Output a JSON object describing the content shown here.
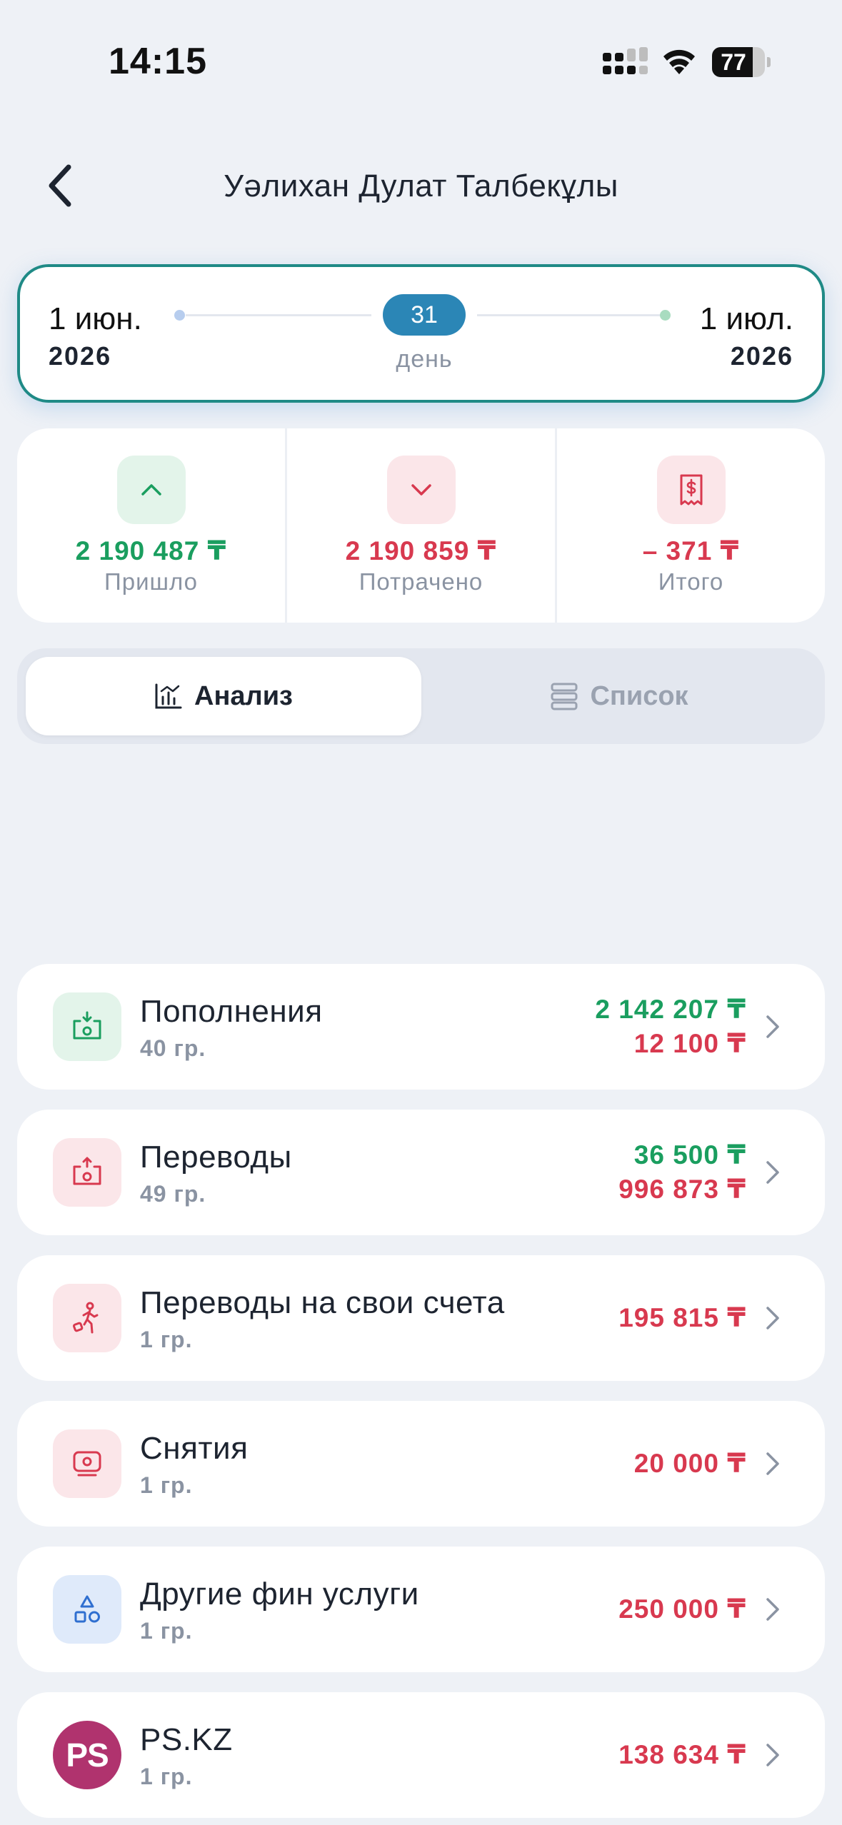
{
  "status_bar": {
    "time": "14:15",
    "battery": "77",
    "battery_level": 0.77
  },
  "header": {
    "title": "Уәлихан Дулат Талбекұлы",
    "back_icon": "chevron-left-icon"
  },
  "period": {
    "start_day": "1 июн.",
    "start_year": "2026",
    "end_day": "1 июл.",
    "end_year": "2026",
    "days_count": "31",
    "days_label": "день"
  },
  "summary": {
    "income": {
      "value": "2 190 487 ₸",
      "label": "Пришло",
      "icon": "chevron-up-icon",
      "color": "#1a9e5f"
    },
    "spent": {
      "value": "2 190 859 ₸",
      "label": "Потрачено",
      "icon": "chevron-down-icon",
      "color": "#d8394f"
    },
    "total": {
      "value": "– 371 ₸",
      "label": "Итого",
      "icon": "receipt-icon",
      "color": "#d8394f"
    }
  },
  "tabs": [
    {
      "label": "Анализ",
      "icon": "chart-icon",
      "active": true
    },
    {
      "label": "Список",
      "icon": "list-icon",
      "active": false
    }
  ],
  "categories": [
    {
      "title": "Пополнения",
      "sub": "40 гр.",
      "in": "2 142 207 ₸",
      "out": "12 100 ₸",
      "icon": "deposit-icon"
    },
    {
      "title": "Переводы",
      "sub": "49 гр.",
      "in": "36 500 ₸",
      "out": "996 873 ₸",
      "icon": "transfer-icon"
    },
    {
      "title": "Переводы на свои счета",
      "sub": "1 гр.",
      "out": "195 815 ₸",
      "icon": "own-accounts-transfer-icon"
    },
    {
      "title": "Снятия",
      "sub": "1 гр.",
      "out": "20 000 ₸",
      "icon": "withdrawal-icon"
    },
    {
      "title": "Другие фин услуги",
      "sub": "1 гр.",
      "out": "250 000 ₸",
      "icon": "shapes-icon"
    },
    {
      "title": "PS.KZ",
      "sub": "1 гр.",
      "out": "138 634 ₸",
      "icon": "ps-kz-logo",
      "logo_text": "PS"
    }
  ]
}
